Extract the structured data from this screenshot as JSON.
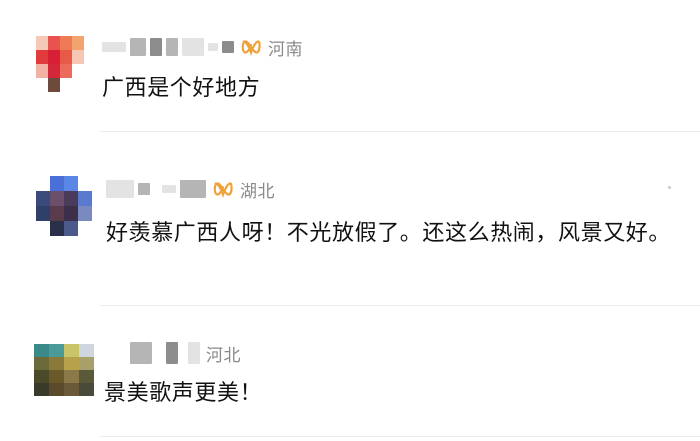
{
  "comments": [
    {
      "location": "河南",
      "text": "广西是个好地方",
      "has_vip_icon": true
    },
    {
      "location": "湖北",
      "text": "好羡慕广西人呀！不光放假了。还这么热闹，风景又好。",
      "has_vip_icon": true
    },
    {
      "location": "河北",
      "text": "景美歌声更美！",
      "has_vip_icon": false
    }
  ],
  "colors": {
    "vip_accent": "#f0a23a",
    "location_text": "#8a8a8a",
    "divider": "#ececec"
  },
  "icons": {
    "vip": "vip-membership-icon"
  }
}
